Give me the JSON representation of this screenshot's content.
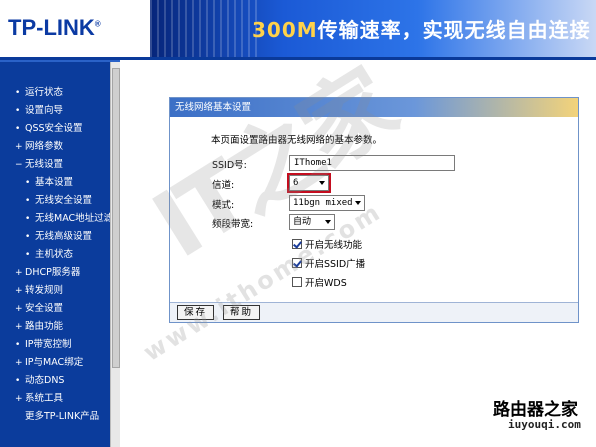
{
  "header": {
    "logo": "TP-LINK",
    "logo_reg": "®",
    "slogan_highlight": "300M",
    "slogan_rest": "传输速率，实现无线自由连接"
  },
  "sidebar": {
    "items": [
      {
        "label": "运行状态",
        "level": 1,
        "bullet": "•"
      },
      {
        "label": "设置向导",
        "level": 1,
        "bullet": "•"
      },
      {
        "label": "QSS安全设置",
        "level": 1,
        "bullet": "•"
      },
      {
        "label": "网络参数",
        "level": 1,
        "bullet": "+"
      },
      {
        "label": "无线设置",
        "level": 1,
        "bullet": "−"
      },
      {
        "label": "基本设置",
        "level": 2,
        "bullet": "•"
      },
      {
        "label": "无线安全设置",
        "level": 2,
        "bullet": "•"
      },
      {
        "label": "无线MAC地址过滤",
        "level": 2,
        "bullet": "•"
      },
      {
        "label": "无线高级设置",
        "level": 2,
        "bullet": "•"
      },
      {
        "label": "主机状态",
        "level": 2,
        "bullet": "•"
      },
      {
        "label": "DHCP服务器",
        "level": 1,
        "bullet": "+"
      },
      {
        "label": "转发规则",
        "level": 1,
        "bullet": "+"
      },
      {
        "label": "安全设置",
        "level": 1,
        "bullet": "+"
      },
      {
        "label": "路由功能",
        "level": 1,
        "bullet": "+"
      },
      {
        "label": "IP带宽控制",
        "level": 1,
        "bullet": "•"
      },
      {
        "label": "IP与MAC绑定",
        "level": 1,
        "bullet": "+"
      },
      {
        "label": "动态DNS",
        "level": 1,
        "bullet": "•"
      },
      {
        "label": "系统工具",
        "level": 1,
        "bullet": "+"
      },
      {
        "label": "更多TP-LINK产品",
        "level": 1,
        "bullet": ""
      }
    ]
  },
  "panel": {
    "title": "无线网络基本设置",
    "description": "本页面设置路由器无线网络的基本参数。",
    "ssid_label": "SSID号:",
    "ssid_value": "IThome1",
    "channel_label": "信道:",
    "channel_value": "6",
    "mode_label": "模式:",
    "mode_value": "11bgn mixed",
    "bandwidth_label": "频段带宽:",
    "bandwidth_value": "自动",
    "enable_wireless": {
      "label": "开启无线功能",
      "checked": true
    },
    "enable_ssid_broadcast": {
      "label": "开启SSID广播",
      "checked": true
    },
    "enable_wds": {
      "label": "开启WDS",
      "checked": false
    },
    "save_label": "保存",
    "help_label": "帮助"
  },
  "watermark": {
    "big": "IT之家",
    "url": "www.ithome.com",
    "corner": "路由器之家",
    "corner_small": "iuyouqi.com"
  },
  "colors": {
    "sidebar_bg": "#0b3c9c",
    "highlight_border": "#c40d1f"
  }
}
